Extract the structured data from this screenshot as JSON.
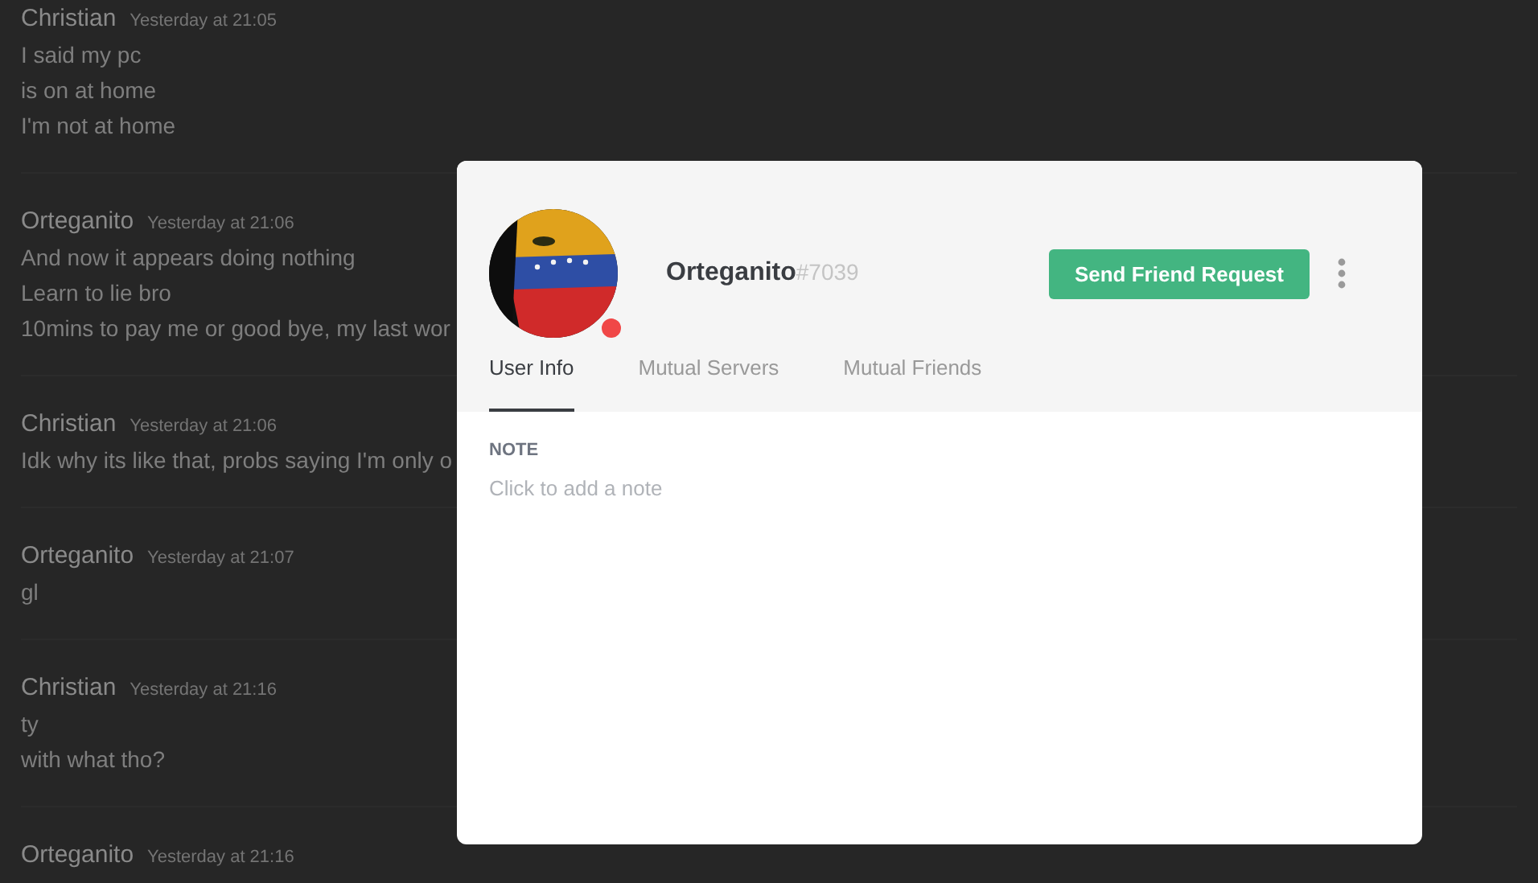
{
  "chat": [
    {
      "author": "Christian",
      "time": "Yesterday at 21:05",
      "lines": [
        "I said my pc",
        "is on at home",
        "I'm not at home"
      ]
    },
    {
      "author": "Orteganito",
      "time": "Yesterday at 21:06",
      "lines": [
        "And now it appears doing nothing",
        "Learn to lie bro",
        "10mins to pay me or good bye, my last wor"
      ]
    },
    {
      "author": "Christian",
      "time": "Yesterday at 21:06",
      "lines": [
        "Idk why its like that, probs saying I'm only o"
      ]
    },
    {
      "author": "Orteganito",
      "time": "Yesterday at 21:07",
      "lines": [
        "gl"
      ]
    },
    {
      "author": "Christian",
      "time": "Yesterday at 21:16",
      "lines": [
        "ty",
        "with what tho?"
      ]
    },
    {
      "author": "Orteganito",
      "time": "Yesterday at 21:16"
    }
  ],
  "profile": {
    "username": "Orteganito",
    "discriminator": "#7039",
    "busy": true,
    "action": "Send Friend Request",
    "tabs": [
      {
        "label": "User Info",
        "selected": true
      },
      {
        "label": "Mutual Servers",
        "selected": false
      },
      {
        "label": "Mutual Friends",
        "selected": false
      }
    ],
    "note": {
      "heading": "NOTE",
      "placeholder": "Click to add a note"
    }
  }
}
